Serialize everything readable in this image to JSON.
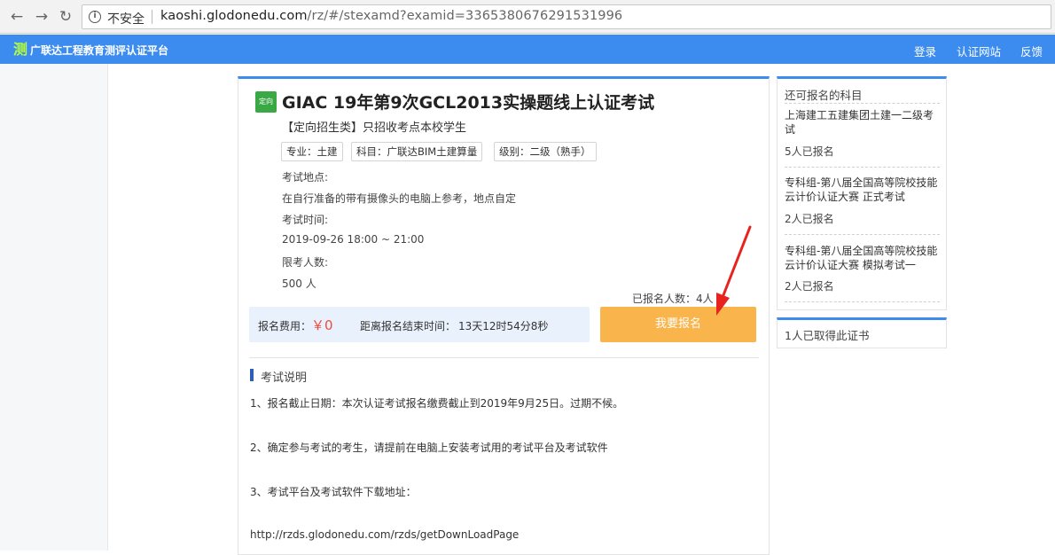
{
  "browser": {
    "back_icon": "arrow-left-icon",
    "forward_icon": "arrow-right-icon",
    "reload_icon": "reload-icon",
    "security_text": "不安全",
    "url_host": "kaoshi.glodonedu.com",
    "url_path": "/rz/#/stexamd?examid=3365380676291531996"
  },
  "header": {
    "logo_glyph": "测",
    "title": "广联达工程教育测评认证平台",
    "nav": [
      "登录",
      "认证网站",
      "反馈"
    ]
  },
  "exam": {
    "badge": "定向",
    "title": "GIAC 19年第9次GCL2013实操题线上认证考试",
    "category": "【定向招生类】只招收考点本校学生",
    "tags": [
      "专业：土建",
      "科目：广联达BIM土建算量",
      "级别：二级（熟手）"
    ],
    "location_label": "考试地点:",
    "location_value": "在自行准备的带有摄像头的电脑上参考，地点自定",
    "time_label": "考试时间:",
    "time_value": "2019-09-26 18:00 ~ 21:00",
    "limit_label": "限考人数:",
    "limit_value": "500 人",
    "registered": "已报名人数：4人",
    "fee_label": "报名费用：",
    "fee_value": "￥0",
    "countdown_label": "距离报名结束时间：",
    "countdown_value": "13天12时54分8秒",
    "signup_button": "我要报名"
  },
  "description": {
    "section_title": "考试说明",
    "lines": [
      "1、报名截止日期：本次认证考试报名缴费截止到2019年9月25日。过期不候。",
      "2、确定参与考试的考生，请提前在电脑上安装考试用的考试平台及考试软件",
      "3、考试平台及考试软件下载地址：",
      "http://rzds.glodonedu.com/rzds/getDownLoadPage"
    ]
  },
  "sidebar": {
    "heading": "还可报名的科目",
    "items": [
      {
        "title": "上海建工五建集团土建一二级考试",
        "count": "5人已报名"
      },
      {
        "title": "专科组-第八届全国高等院校技能云计价认证大赛 正式考试",
        "count": "2人已报名"
      },
      {
        "title": "专科组-第八届全国高等院校技能云计价认证大赛 模拟考试一",
        "count": "2人已报名"
      }
    ],
    "certificate_text": "1人已取得此证书"
  },
  "colors": {
    "header_blue": "#3c8cf0",
    "signup_orange": "#f9b54b",
    "fee_red": "#f04b3d",
    "annotation_red": "#e8231e"
  }
}
